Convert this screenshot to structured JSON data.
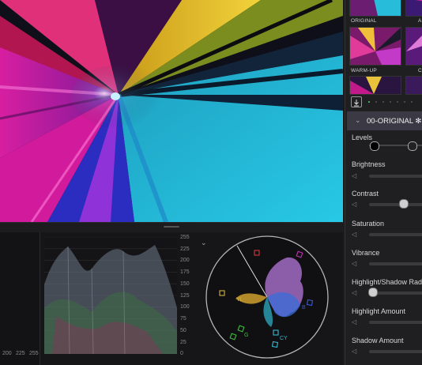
{
  "scopes": {
    "waveform_ticks": [
      "255",
      "225",
      "200",
      "175",
      "150",
      "125",
      "100",
      "75",
      "50",
      "25",
      "0"
    ],
    "bottom_ticks": [
      "200",
      "225",
      "255"
    ],
    "vectorscope_labels": {
      "yl": "YL",
      "g": "G",
      "cy": "CY",
      "b": "B"
    }
  },
  "sidebar": {
    "thumbnails": [
      {
        "label": "ORIGINAL"
      },
      {
        "label": "AI"
      },
      {
        "label": "WARM-UP"
      },
      {
        "label": "CI"
      }
    ],
    "preset_title": "00-ORIGINAL ✻",
    "controls": [
      {
        "label": "Levels"
      },
      {
        "label": "Brightness"
      },
      {
        "label": "Contrast",
        "value_fraction": 0.55
      },
      {
        "label": "Saturation"
      },
      {
        "label": "Vibrance"
      },
      {
        "label": "Highlight/Shadow Radius",
        "value_fraction": 0.12
      },
      {
        "label": "Highlight Amount"
      },
      {
        "label": "Shadow Amount"
      }
    ]
  },
  "colors": {
    "accent": "#4aa3ff",
    "panel": "#1f1f21",
    "header": "#3b3a44"
  }
}
